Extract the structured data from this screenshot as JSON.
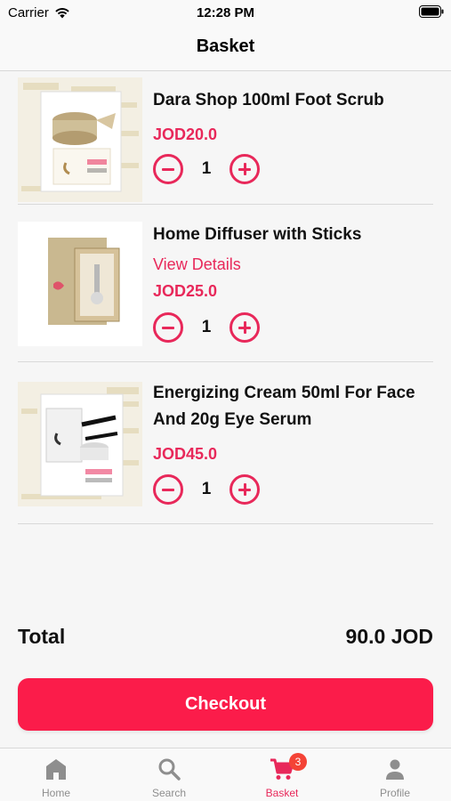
{
  "status_bar": {
    "carrier": "Carrier",
    "time": "12:28 PM"
  },
  "header": {
    "title": "Basket"
  },
  "cart": {
    "items": [
      {
        "name": "Dara Shop 100ml Foot Scrub",
        "price": "JOD20.0",
        "quantity": "1",
        "image_icon": "foot-scrub-jar"
      },
      {
        "name": "Home Diffuser with Sticks",
        "link": "View Details",
        "price": "JOD25.0",
        "quantity": "1",
        "image_icon": "diffuser-box"
      },
      {
        "name": "Energizing Cream 50ml For Face And 20g Eye Serum",
        "price": "JOD45.0",
        "quantity": "1",
        "image_icon": "cream-gift-box"
      }
    ]
  },
  "summary": {
    "total_label": "Total",
    "total_value": "90.0 JOD"
  },
  "checkout": {
    "label": "Checkout"
  },
  "tab_bar": {
    "tabs": [
      {
        "label": "Home",
        "icon": "home-icon"
      },
      {
        "label": "Search",
        "icon": "search-icon"
      },
      {
        "label": "Basket",
        "icon": "cart-icon",
        "badge": "3"
      },
      {
        "label": "Profile",
        "icon": "person-icon"
      }
    ]
  },
  "colors": {
    "accent": "#e8285a",
    "checkout": "#fb1c4a",
    "badge": "#f44336"
  }
}
